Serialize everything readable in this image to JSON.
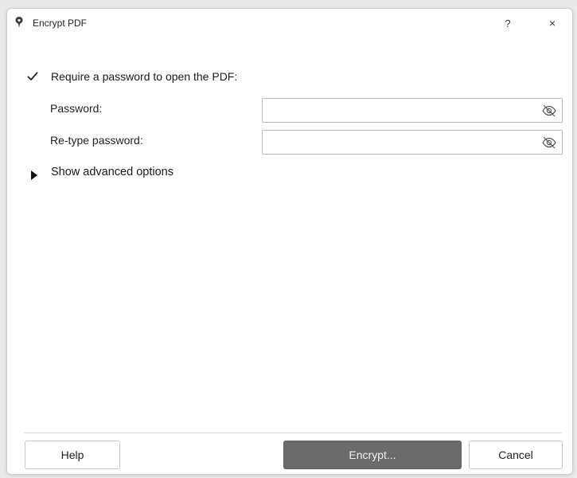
{
  "window": {
    "title": "Encrypt PDF",
    "help_glyph": "?",
    "close_glyph": "×",
    "app_icon": "pin-icon"
  },
  "form": {
    "require_password": {
      "label": "Require a password to open the PDF:",
      "checked": true
    },
    "password": {
      "label": "Password:",
      "value": "",
      "visibility_icon": "eye-slash-icon"
    },
    "retype_password": {
      "label": "Re-type password:",
      "value": "",
      "visibility_icon": "eye-slash-icon"
    },
    "advanced": {
      "label": "Show advanced options",
      "expanded": false
    }
  },
  "buttons": {
    "help": "Help",
    "encrypt": "Encrypt...",
    "cancel": "Cancel"
  },
  "colors": {
    "primary_button": "#6b6b6b",
    "window_background": "#ffffff",
    "desktop_background": "#e9e9e9"
  }
}
